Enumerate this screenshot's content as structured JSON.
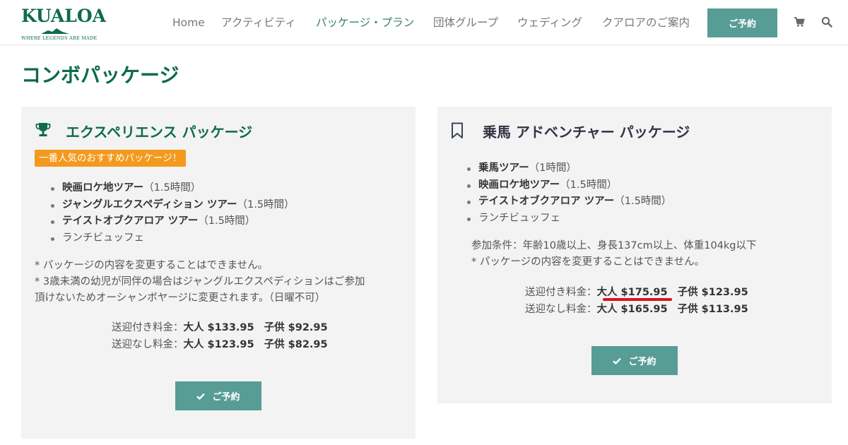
{
  "header": {
    "logo": {
      "wordmark": "KUALOA",
      "tagline": "WHERE LEGENDS ARE MADE"
    },
    "nav": [
      {
        "label": "Home",
        "active": false
      },
      {
        "label": "アクティビティ",
        "active": false
      },
      {
        "label": "パッケージ・プラン",
        "active": true
      },
      {
        "label": "団体グループ",
        "active": false
      },
      {
        "label": "ウェディング",
        "active": false
      },
      {
        "label": "クアロアのご案内",
        "active": false
      }
    ],
    "reserve_label": "ご予約",
    "icons": [
      "cart-icon",
      "search-icon"
    ]
  },
  "page_title": "コンボパッケージ",
  "cards": [
    {
      "title": "エクスペリエンス パッケージ",
      "icon": "trophy-icon",
      "badge": "一番人気のおすすめパッケージ！",
      "items": [
        {
          "name": "映画ロケ地ツアー",
          "detail": "（1.5時間）"
        },
        {
          "name": "ジャングルエクスペディション ツアー",
          "detail": "（1.5時間）"
        },
        {
          "name": "テイストオブクアロア ツアー",
          "detail": "（1.5時間）"
        },
        {
          "name": "",
          "detail": "ランチビュッフェ"
        }
      ],
      "notes": [
        "* パッケージの内容を変更することはできません。",
        "* 3歳未満の幼児が同伴の場合はジャングルエクスペディションはご参加",
        "頂けないためオーシャンボヤージに変更されます。（日曜不可）"
      ],
      "prices": [
        {
          "label": "送迎付き料金：",
          "adult": "大人 $133.95",
          "child": "子供 $92.95"
        },
        {
          "label": "送迎なし料金：",
          "adult": "大人 $123.95",
          "child": "子供 $82.95"
        }
      ],
      "button_label": "ご予約"
    },
    {
      "title": "乗馬 アドベンチャー パッケージ",
      "icon": "bookmark-icon",
      "items": [
        {
          "name": "乗馬ツアー",
          "detail": "（1時間）"
        },
        {
          "name": "映画ロケ地ツアー",
          "detail": "（1.5時間）"
        },
        {
          "name": "テイストオブクアロア ツアー",
          "detail": "（1.5時間）"
        },
        {
          "name": "",
          "detail": "ランチビュッフェ"
        }
      ],
      "notes": [
        "参加条件：年齢10歳以上、身長137cm以上、体重104kg以下",
        "* パッケージの内容を変更することはできません。"
      ],
      "prices": [
        {
          "label": "送迎付き料金：",
          "adult": "大人 $175.95",
          "child": "子供 $123.95"
        },
        {
          "label": "送迎なし料金：",
          "adult": "大人 $165.95",
          "child": "子供 $113.95"
        }
      ],
      "button_label": "ご予約"
    }
  ],
  "colors": {
    "brand_green": "#0e6b4c",
    "button_teal": "#579d95",
    "badge_orange": "#f39a1e",
    "card_bg": "#f3f3f3",
    "annotation_red": "#d7151a"
  }
}
